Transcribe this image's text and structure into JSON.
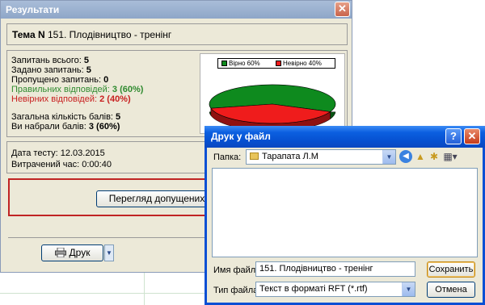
{
  "results_window": {
    "title": "Результати",
    "close_glyph": "✕",
    "theme_label": "Тема N",
    "theme_value": "151. Плодівництво - тренінг",
    "stats": {
      "asked_total_label": "Запитань всього:",
      "asked_total_value": "5",
      "given_label": "Задано запитань:",
      "given_value": "5",
      "skipped_label": "Пропущено запитань:",
      "skipped_value": "0",
      "correct_label": "Правильних відповідей:",
      "correct_value": "3 (60%)",
      "wrong_label": "Невірних відповідей:",
      "wrong_value": "2 (40%)",
      "total_score_label": "Загальна кількість балів:",
      "total_score_value": "5",
      "earned_label": "Ви набрали балів:",
      "earned_value": "3 (60%)"
    },
    "date_label": "Дата тесту:",
    "date_value": "12.03.2015",
    "time_label": "Витрачений час:",
    "time_value": "0:00:40",
    "review_button": "Перегляд допущених",
    "print_button": "Друк",
    "print_icon": "printer-icon"
  },
  "chart_data": {
    "type": "pie",
    "categories": [
      "Вірно 60%",
      "Невірно 40%"
    ],
    "values": [
      60,
      40
    ],
    "colors": [
      "#0e8a1e",
      "#ef1c1c"
    ],
    "legend_placement": "top"
  },
  "save_dialog": {
    "title": "Друк у файл",
    "help_glyph": "?",
    "close_glyph": "✕",
    "folder_label": "Папка:",
    "folder_value": "Тарапата Л.М",
    "filename_label": "Имя файла:",
    "filename_value": "151. Плодівництво - тренінг",
    "filetype_label": "Тип файла:",
    "filetype_value": "Текст в форматі RFT (*.rtf)",
    "save_button": "Сохранить",
    "cancel_button": "Отмена",
    "toolbar_icons": [
      "back-icon",
      "up-folder-icon",
      "new-folder-icon",
      "view-menu-icon"
    ]
  }
}
